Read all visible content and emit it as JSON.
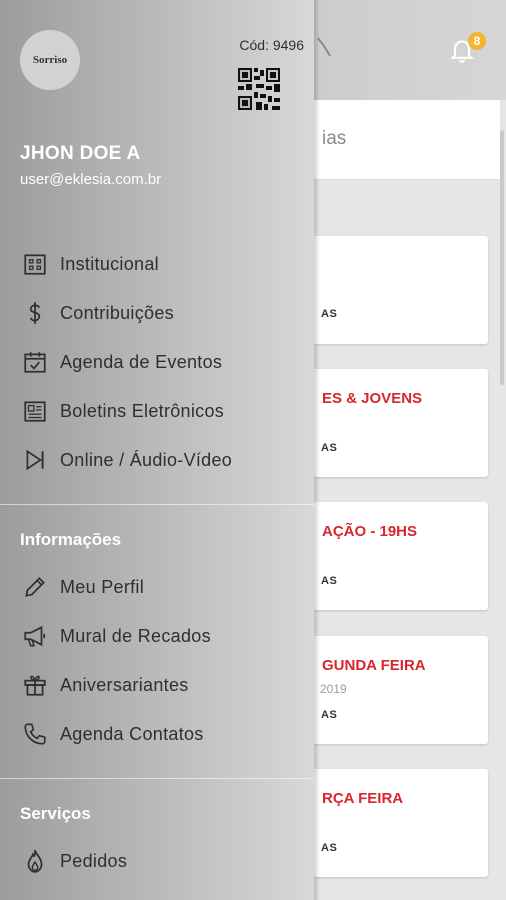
{
  "app": {
    "notification_count": "8",
    "subbar_text": "ias",
    "cards": [
      {
        "title": "",
        "date": "",
        "tag": "AS"
      },
      {
        "title": "ES & JOVENS",
        "date": "",
        "tag": "AS"
      },
      {
        "title": "AÇÃO - 19HS",
        "date": "",
        "tag": "AS"
      },
      {
        "title": "GUNDA FEIRA",
        "date": "2019",
        "tag": "AS"
      },
      {
        "title": "RÇA FEIRA",
        "date": "",
        "tag": "AS"
      }
    ]
  },
  "drawer": {
    "logo_text": "Sorriso",
    "code_label": "Cód: 9496",
    "user": {
      "name": "JHON DOE A",
      "email": "user@eklesia.com.br"
    },
    "main_items": [
      {
        "label": "Institucional",
        "icon": "building-icon"
      },
      {
        "label": "Contribuições",
        "icon": "dollar-icon"
      },
      {
        "label": "Agenda de Eventos",
        "icon": "calendar-check-icon"
      },
      {
        "label": "Boletins Eletrônicos",
        "icon": "newspaper-icon"
      },
      {
        "label": "Online / Áudio-Vídeo",
        "icon": "play-skip-icon"
      }
    ],
    "info_section": {
      "title": "Informações",
      "items": [
        {
          "label": "Meu Perfil",
          "icon": "pencil-icon"
        },
        {
          "label": "Mural de Recados",
          "icon": "megaphone-icon"
        },
        {
          "label": "Aniversariantes",
          "icon": "gift-icon"
        },
        {
          "label": "Agenda Contatos",
          "icon": "phone-icon"
        }
      ]
    },
    "services_section": {
      "title": "Serviços",
      "items": [
        {
          "label": "Pedidos",
          "icon": "flame-icon"
        }
      ]
    }
  },
  "colors": {
    "accent_red": "#d8262c",
    "badge": "#f2b632",
    "drawer_text": "#2f2f2f"
  }
}
